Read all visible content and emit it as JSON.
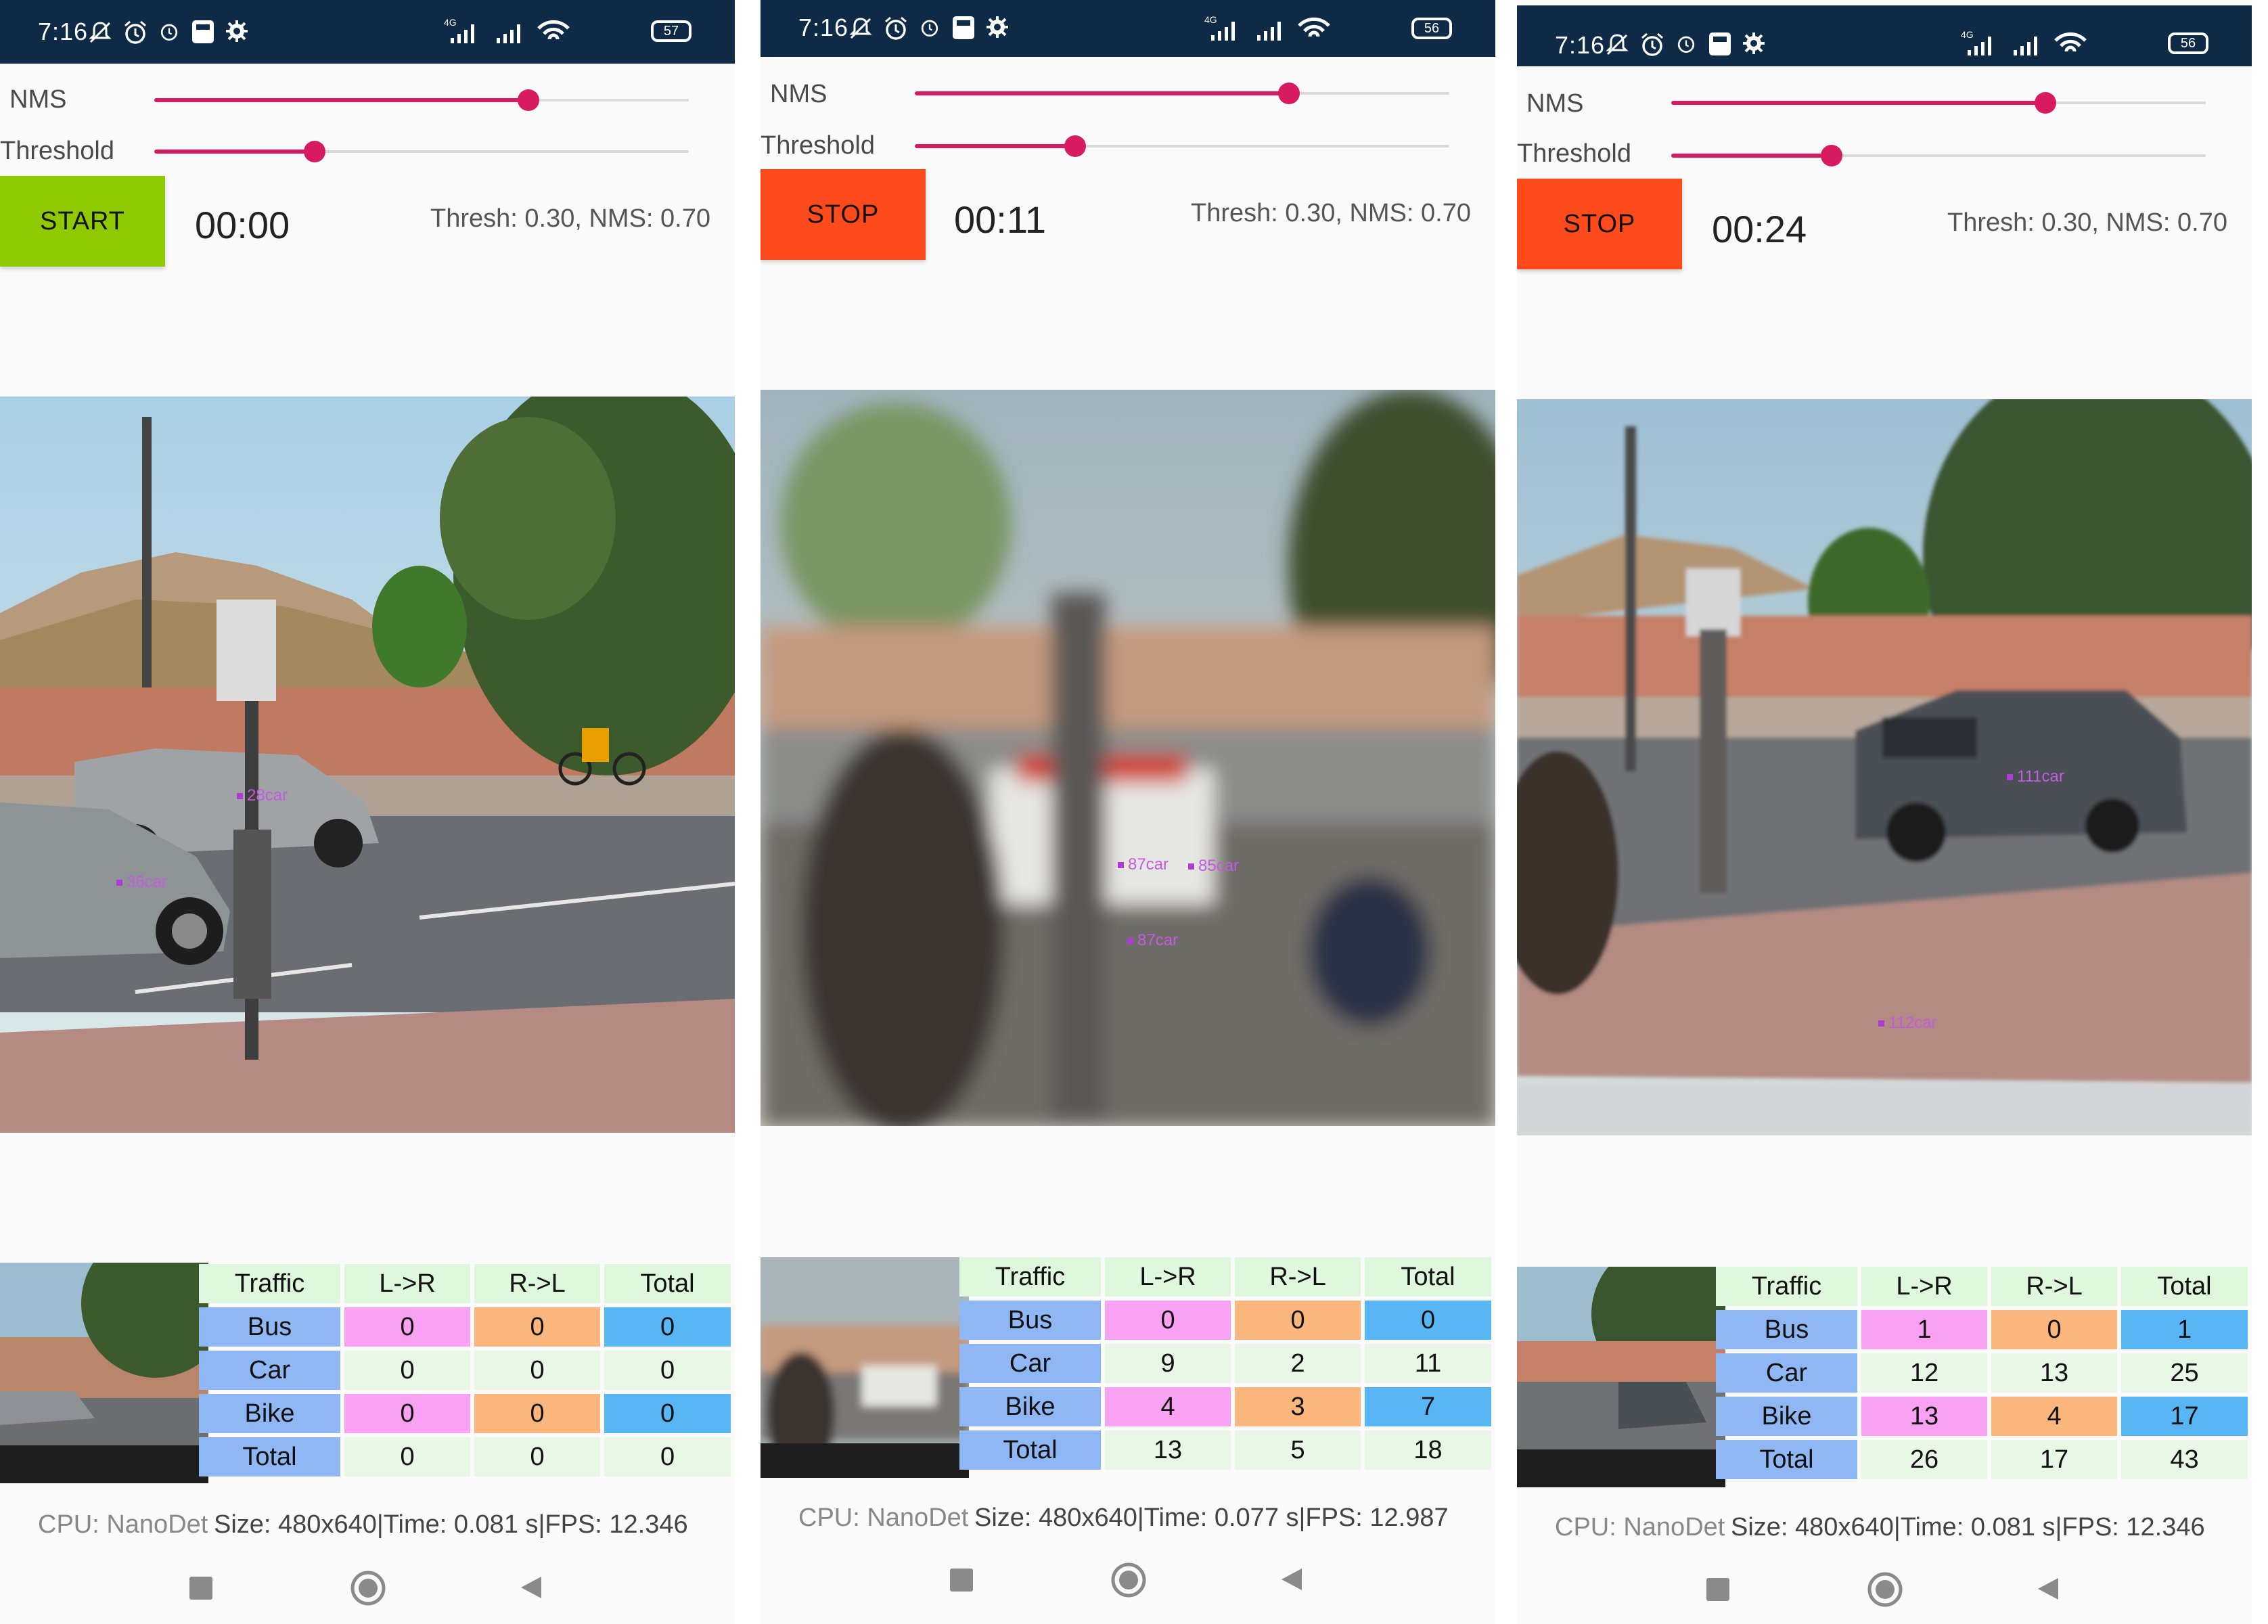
{
  "screens": [
    {
      "status_time": "7:16",
      "battery": "57",
      "network": "4G",
      "nms_label": "NMS",
      "threshold_label": "Threshold",
      "nms_value": 0.7,
      "threshold_value": 0.3,
      "button_label": "START",
      "button_color": "#8fca00",
      "timer": "00:00",
      "params_text": "Thresh: 0.30, NMS: 0.70",
      "detections": [
        "28car",
        "36car"
      ],
      "table": {
        "headers": [
          "Traffic",
          "L->R",
          "R->L",
          "Total"
        ],
        "rows": [
          {
            "label": "Bus",
            "ltr": "0",
            "rtl": "0",
            "total": "0"
          },
          {
            "label": "Car",
            "ltr": "0",
            "rtl": "0",
            "total": "0"
          },
          {
            "label": "Bike",
            "ltr": "0",
            "rtl": "0",
            "total": "0"
          },
          {
            "label": "Total",
            "ltr": "0",
            "rtl": "0",
            "total": "0"
          }
        ]
      },
      "info_prefix": "CPU: NanoDet",
      "info_text": "Size: 480x640|Time: 0.081 s|FPS: 12.346"
    },
    {
      "status_time": "7:16",
      "battery": "56",
      "network": "4G",
      "nms_label": "NMS",
      "threshold_label": "Threshold",
      "nms_value": 0.7,
      "threshold_value": 0.3,
      "button_label": "STOP",
      "button_color": "#ff4a1c",
      "timer": "00:11",
      "params_text": "Thresh: 0.30, NMS: 0.70",
      "detections": [
        "87car",
        "85car",
        "87car"
      ],
      "table": {
        "headers": [
          "Traffic",
          "L->R",
          "R->L",
          "Total"
        ],
        "rows": [
          {
            "label": "Bus",
            "ltr": "0",
            "rtl": "0",
            "total": "0"
          },
          {
            "label": "Car",
            "ltr": "9",
            "rtl": "2",
            "total": "11"
          },
          {
            "label": "Bike",
            "ltr": "4",
            "rtl": "3",
            "total": "7"
          },
          {
            "label": "Total",
            "ltr": "13",
            "rtl": "5",
            "total": "18"
          }
        ]
      },
      "info_prefix": "CPU: NanoDet",
      "info_text": "Size: 480x640|Time: 0.077 s|FPS: 12.987"
    },
    {
      "status_time": "7:16",
      "battery": "56",
      "network": "4G",
      "nms_label": "NMS",
      "threshold_label": "Threshold",
      "nms_value": 0.7,
      "threshold_value": 0.3,
      "button_label": "STOP",
      "button_color": "#ff4a1c",
      "timer": "00:24",
      "params_text": "Thresh: 0.30, NMS: 0.70",
      "detections": [
        "111car",
        "112car"
      ],
      "table": {
        "headers": [
          "Traffic",
          "L->R",
          "R->L",
          "Total"
        ],
        "rows": [
          {
            "label": "Bus",
            "ltr": "1",
            "rtl": "0",
            "total": "1"
          },
          {
            "label": "Car",
            "ltr": "12",
            "rtl": "13",
            "total": "25"
          },
          {
            "label": "Bike",
            "ltr": "13",
            "rtl": "4",
            "total": "17"
          },
          {
            "label": "Total",
            "ltr": "26",
            "rtl": "17",
            "total": "43"
          }
        ]
      },
      "info_prefix": "CPU: NanoDet",
      "info_text": "Size: 480x640|Time: 0.081 s|FPS: 12.346"
    }
  ],
  "colors": {
    "status_bar": "#0f2a47",
    "slider_accent": "#d81b60",
    "table_header": "#dff7dc",
    "table_row_label": "#8fb7f4",
    "bus_bike_ltr": "#f9a1f2",
    "bus_bike_rtl": "#fbb67e",
    "bus_bike_total": "#58b6f4"
  },
  "icons": [
    "mute-icon",
    "alarm-icon",
    "alarm-icon",
    "gallery-icon",
    "settings-icon",
    "signal-icon",
    "wifi-icon",
    "battery-icon",
    "nav-recents-icon",
    "nav-home-icon",
    "nav-back-icon"
  ]
}
